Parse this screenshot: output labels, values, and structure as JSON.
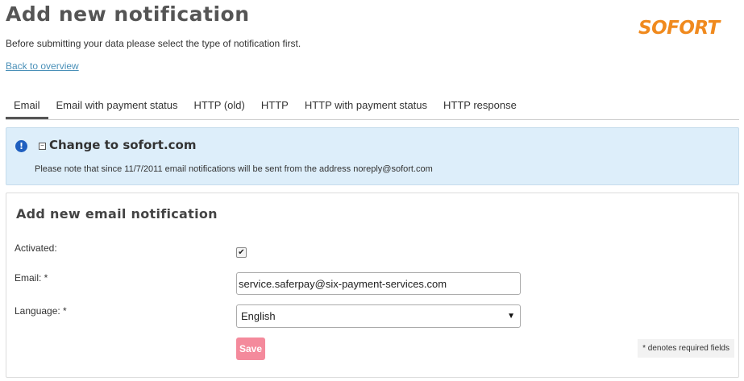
{
  "header": {
    "title": "Add new notification",
    "logo": "SOFORT",
    "intro": "Before submitting your data please select the type of notification first.",
    "back_link": "Back to overview"
  },
  "tabs": [
    {
      "label": "Email",
      "active": true
    },
    {
      "label": "Email with payment status",
      "active": false
    },
    {
      "label": "HTTP (old)",
      "active": false
    },
    {
      "label": "HTTP",
      "active": false
    },
    {
      "label": "HTTP with payment status",
      "active": false
    },
    {
      "label": "HTTP response",
      "active": false
    }
  ],
  "info": {
    "title": "Change to sofort.com",
    "text": "Please note that since 11/7/2011 email notifications will be sent from the address noreply@sofort.com"
  },
  "form": {
    "title": "Add new email notification",
    "activated_label": "Activated:",
    "activated_checked": true,
    "email_label": "Email: *",
    "email_value": "service.saferpay@six-payment-services.com",
    "language_label": "Language: *",
    "language_value": "English",
    "save_label": "Save",
    "required_note": "* denotes required fields"
  },
  "colors": {
    "logo": "#f08a1e",
    "info_background": "#ddeefa",
    "info_icon": "#1f5fbf",
    "save_button": "#f48a9c",
    "link": "#4a90b8"
  }
}
